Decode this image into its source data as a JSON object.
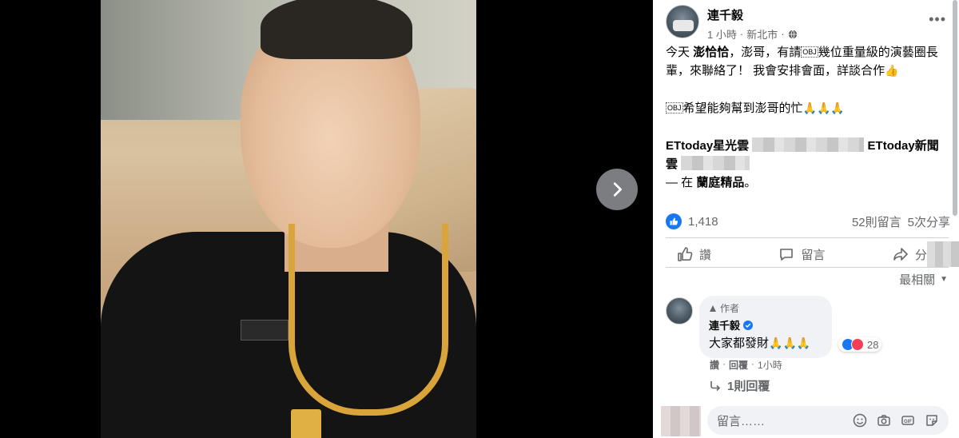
{
  "post": {
    "author": "連千毅",
    "time": "1 小時",
    "location": "新北市",
    "separator": "·",
    "line1_prefix": "今天",
    "mention": "澎恰恰",
    "line1_rest": "，澎哥，有請",
    "obj": "OBJ",
    "line1_end": "幾位重量級的演藝圈長輩，來聯絡了！ 我會安排會面，詳談合作",
    "line2": "希望能夠幫到澎哥的忙",
    "tag1": "ETtoday星光雲",
    "tag2": "ETtoday新聞雲",
    "place_prefix": "— 在",
    "place": "蘭庭精品",
    "place_suffix": "。"
  },
  "stats": {
    "likes": "1,418",
    "comments": "52則留言",
    "shares": "5次分享"
  },
  "actions": {
    "like": "讚",
    "comment": "留言",
    "share": "分享"
  },
  "sort": {
    "label": "最相關"
  },
  "comment": {
    "author_tag": "作者",
    "name": "連千毅",
    "text": "大家都發財",
    "reaction_count": "28",
    "like_label": "讚",
    "reply_label": "回覆",
    "dot": "·",
    "time": "1小時",
    "replies": "1則回覆"
  },
  "compose": {
    "placeholder": "留言……"
  },
  "colors": {
    "accent": "#1877f2",
    "text_secondary": "#65676b",
    "love": "#f33e58"
  }
}
